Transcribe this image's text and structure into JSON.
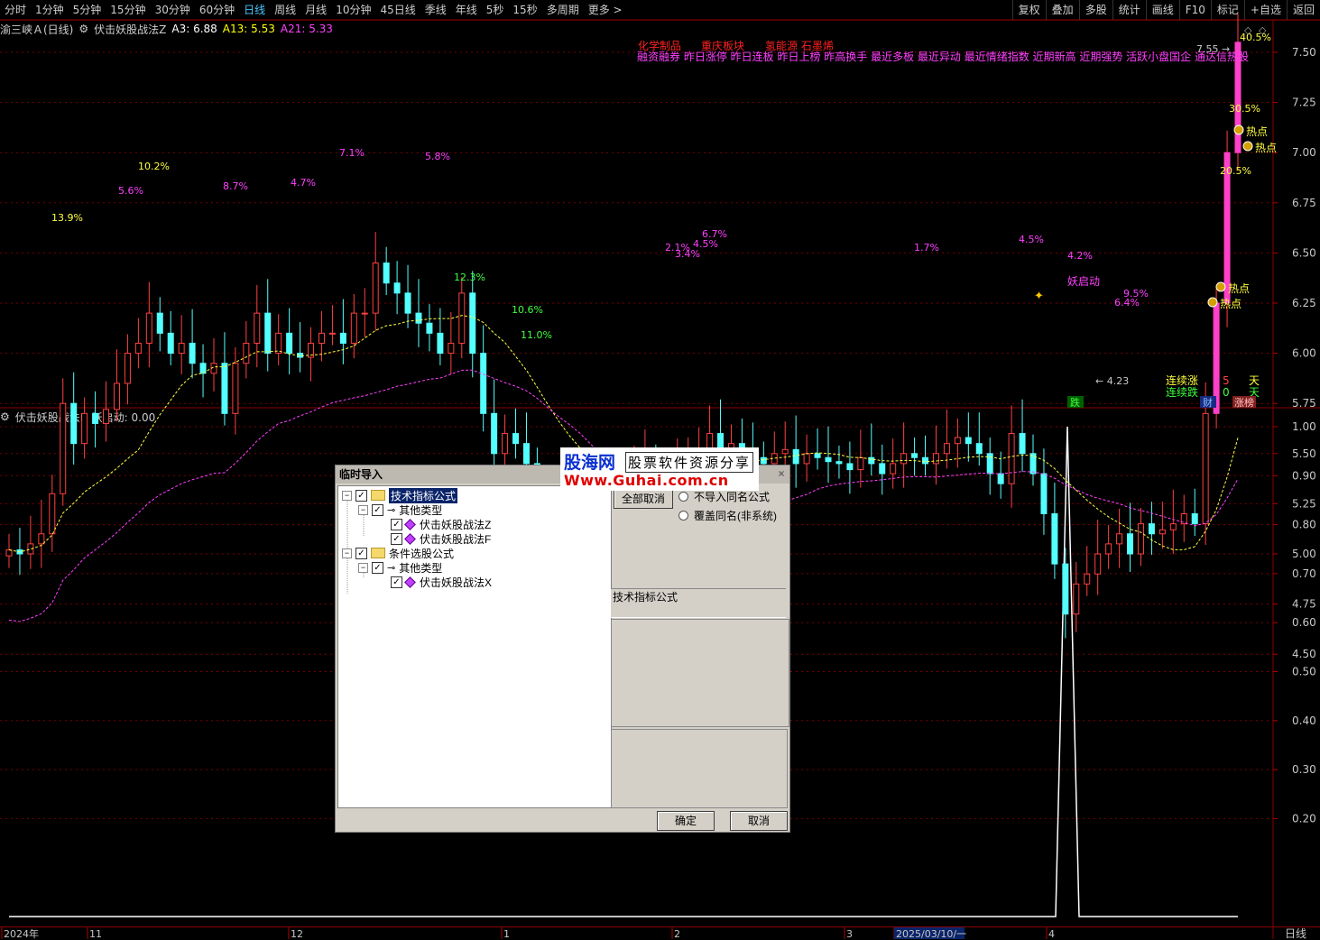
{
  "toolbar": {
    "left_items": [
      "分时",
      "1分钟",
      "5分钟",
      "15分钟",
      "30分钟",
      "60分钟",
      "日线",
      "周线",
      "月线",
      "10分钟",
      "45日线",
      "季线",
      "年线",
      "5秒",
      "15秒",
      "多周期",
      "更多 >"
    ],
    "active": "日线",
    "right_items": [
      "复权",
      "叠加",
      "多股",
      "统计",
      "画线",
      "F10",
      "标记",
      "+自选",
      "返回"
    ]
  },
  "main_chart": {
    "stock": "渝三峡Ａ(日线)",
    "indicator": "伏击妖股战法Z",
    "a3": "A3: 6.88",
    "a13": "A13: 5.53",
    "a21": "A21: 5.33",
    "y_ticks": [
      "7.50",
      "7.25",
      "7.00",
      "6.75",
      "6.50",
      "6.25",
      "6.00",
      "5.75",
      "5.50",
      "5.25",
      "5.00",
      "4.75",
      "4.50"
    ],
    "tags_red": [
      "化学制品",
      "重庆板块",
      "氢能源 石墨烯"
    ],
    "tags_magenta": "融资融券 昨日涨停 昨日连板 昨日上榜 昨高换手 最近多板 最近异动 最近情绪指数 近期新高 近期强势 活跃小盘国企 通达信热股",
    "price_max": "7.55",
    "price_min": "4.23",
    "pct_labels": [
      {
        "t": "13.9%",
        "c": "yellow"
      },
      {
        "t": "10.2%",
        "c": "yellow"
      },
      {
        "t": "5.6%",
        "c": "magenta"
      },
      {
        "t": "8.7%",
        "c": "magenta"
      },
      {
        "t": "4.7%",
        "c": "magenta"
      },
      {
        "t": "7.1%",
        "c": "magenta"
      },
      {
        "t": "5.8%",
        "c": "magenta"
      },
      {
        "t": "12.3%",
        "c": "green"
      },
      {
        "t": "10.6%",
        "c": "green"
      },
      {
        "t": "11.0%",
        "c": "green"
      },
      {
        "t": "2.1%",
        "c": "magenta"
      },
      {
        "t": "3.4%",
        "c": "magenta"
      },
      {
        "t": "6.7%",
        "c": "magenta"
      },
      {
        "t": "4.5%",
        "c": "magenta"
      },
      {
        "t": "1.7%",
        "c": "magenta"
      },
      {
        "t": "4.5%",
        "c": "magenta"
      },
      {
        "t": "4.2%",
        "c": "magenta"
      },
      {
        "t": "6.4%",
        "c": "magenta"
      },
      {
        "t": "9.5%",
        "c": "magenta"
      },
      {
        "t": "20.5%",
        "c": "yellow"
      },
      {
        "t": "30.5%",
        "c": "yellow"
      },
      {
        "t": "40.5%",
        "c": "yellow"
      }
    ],
    "hot_label": "热点",
    "yao_label": "妖启动",
    "streak_up_label": "连续涨",
    "streak_up_val": "5",
    "streak_down_label": "连续跌",
    "streak_down_val": "0",
    "day_unit": "天",
    "flag_fall": "跌",
    "flag_cai": "财",
    "flag_board": "涨榜"
  },
  "sub_chart": {
    "indicator": "伏击妖股战法F",
    "value": "妖启动: 0.00",
    "y_ticks": [
      "1.00",
      "0.90",
      "0.80",
      "0.70",
      "0.60",
      "0.50",
      "0.40",
      "0.30",
      "0.20"
    ]
  },
  "x_axis": {
    "labels": [
      "2024年",
      "11",
      "12",
      "1",
      "2",
      "3",
      "2025/03/10/一",
      "4"
    ],
    "period": "日线"
  },
  "dialog": {
    "title": "临时导入",
    "close": "×",
    "tree": {
      "tech": "技术指标公式",
      "other1": "其他类型",
      "f_z": "伏击妖股战法Z",
      "f_f": "伏击妖股战法F",
      "cond": "条件选股公式",
      "other2": "其他类型",
      "f_x": "伏击妖股战法X"
    },
    "select_all": "全部取消",
    "opt1": "不导入同名公式",
    "opt2": "覆盖同名(非系统)",
    "type_label": "技术指标公式",
    "ok": "确定",
    "cancel": "取消"
  },
  "watermark": {
    "brand": "股海网",
    "slogan": "股票软件资源分享",
    "url": "Www.Guhai.com.cn"
  }
}
